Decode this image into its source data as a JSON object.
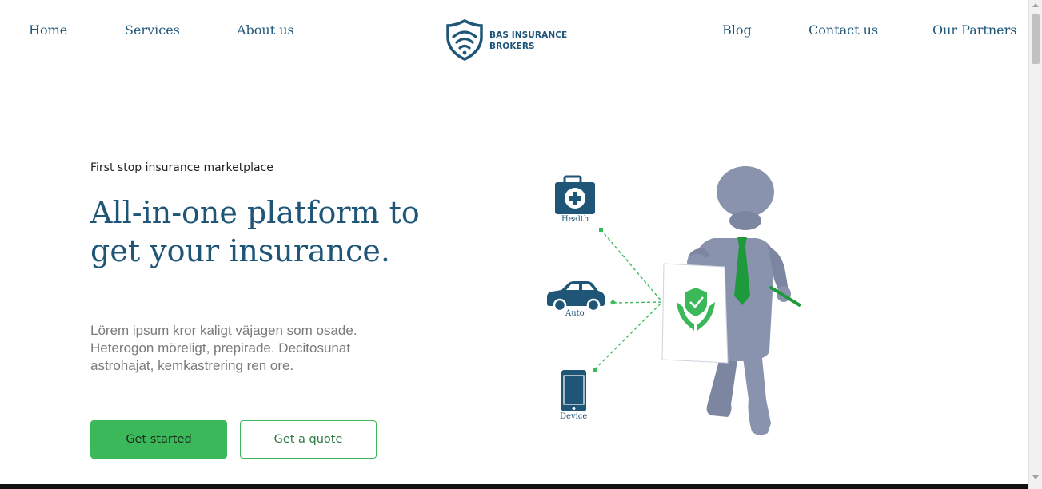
{
  "nav": {
    "left": [
      {
        "label": "Home"
      },
      {
        "label": "Services"
      },
      {
        "label": "About us"
      }
    ],
    "right": [
      {
        "label": "Blog"
      },
      {
        "label": "Contact us"
      },
      {
        "label": "Our Partners"
      }
    ],
    "logo": {
      "line1": "BAS INSURANCE",
      "line2": "BROKERS",
      "icon": "shield-wifi-icon"
    }
  },
  "hero": {
    "eyebrow": "First stop insurance marketplace",
    "headline": "All-in-one platform to get your insurance.",
    "lead": "Lörem ipsum kror kaligt väjagen som osade. Heterogon möreligt, prepirade. Decitosunat astrohajat, kemkastrering ren ore.",
    "primary_cta": "Get started",
    "secondary_cta": "Get a quote"
  },
  "illustration": {
    "items": [
      {
        "label": "Health",
        "icon": "medical-kit-icon"
      },
      {
        "label": "Auto",
        "icon": "car-icon"
      },
      {
        "label": "Device",
        "icon": "phone-icon"
      }
    ],
    "card_icon": "shield-hands-icon",
    "figure": "presenter-figure"
  },
  "colors": {
    "brand_blue": "#1f5678",
    "accent_green": "#3bb95a",
    "figure_gray": "#8a93ad",
    "tie_green": "#1e9a3c"
  }
}
